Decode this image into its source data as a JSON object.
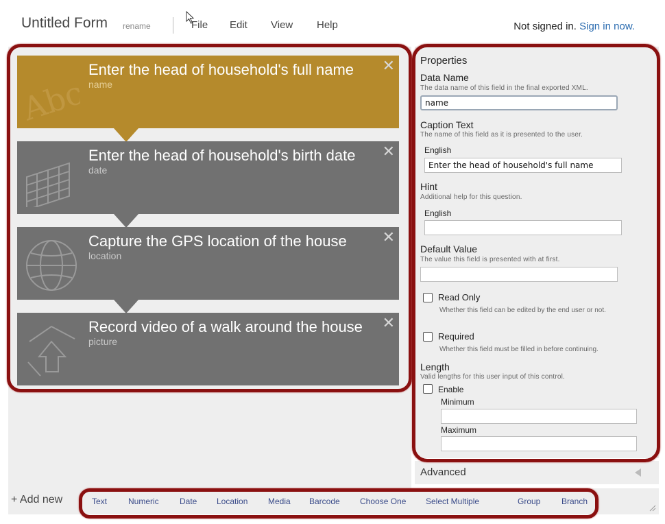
{
  "header": {
    "title": "Untitled Form",
    "rename": "rename",
    "menu": [
      "File",
      "Edit",
      "View",
      "Help"
    ],
    "auth_status": "Not signed in.",
    "auth_link": "Sign in now."
  },
  "controls": [
    {
      "title": "Enter the head of household's full name",
      "name": "name",
      "icon": "text-abc-icon",
      "selected": true,
      "close": "✕"
    },
    {
      "title": "Enter the head of household's birth date",
      "name": "date",
      "icon": "calendar-icon",
      "selected": false,
      "close": "✕"
    },
    {
      "title": "Capture the GPS location of the house",
      "name": "location",
      "icon": "globe-icon",
      "selected": false,
      "close": "✕"
    },
    {
      "title": "Record video of a walk around the house",
      "name": "picture",
      "icon": "upload-media-icon",
      "selected": false,
      "close": "✕"
    }
  ],
  "properties": {
    "heading": "Properties",
    "data_name": {
      "label": "Data Name",
      "desc": "The data name of this field in the final exported XML.",
      "value": "name"
    },
    "caption": {
      "label": "Caption Text",
      "desc": "The name of this field as it is presented to the user.",
      "lang": "English",
      "value": "Enter the head of household's full name"
    },
    "hint": {
      "label": "Hint",
      "desc": "Additional help for this question.",
      "lang": "English",
      "value": ""
    },
    "default": {
      "label": "Default Value",
      "desc": "The value this field is presented with at first.",
      "value": ""
    },
    "read_only": {
      "label": "Read Only",
      "desc": "Whether this field can be edited by the end user or not.",
      "checked": false
    },
    "required": {
      "label": "Required",
      "desc": "Whether this field must be filled in before continuing.",
      "checked": false
    },
    "length": {
      "label": "Length",
      "desc": "Valid lengths for this user input of this control.",
      "enable": "Enable",
      "min": "Minimum",
      "max": "Maximum"
    }
  },
  "advanced": {
    "label": "Advanced"
  },
  "toolbar": {
    "add_new": "+ Add new",
    "items": [
      "Text",
      "Numeric",
      "Date",
      "Location",
      "Media",
      "Barcode",
      "Choose One",
      "Select Multiple",
      "Group",
      "Branch"
    ]
  },
  "colors": {
    "selected": "#b58a2c",
    "control": "#717171",
    "highlight": "#8a1010",
    "link": "#2b6cb0"
  }
}
